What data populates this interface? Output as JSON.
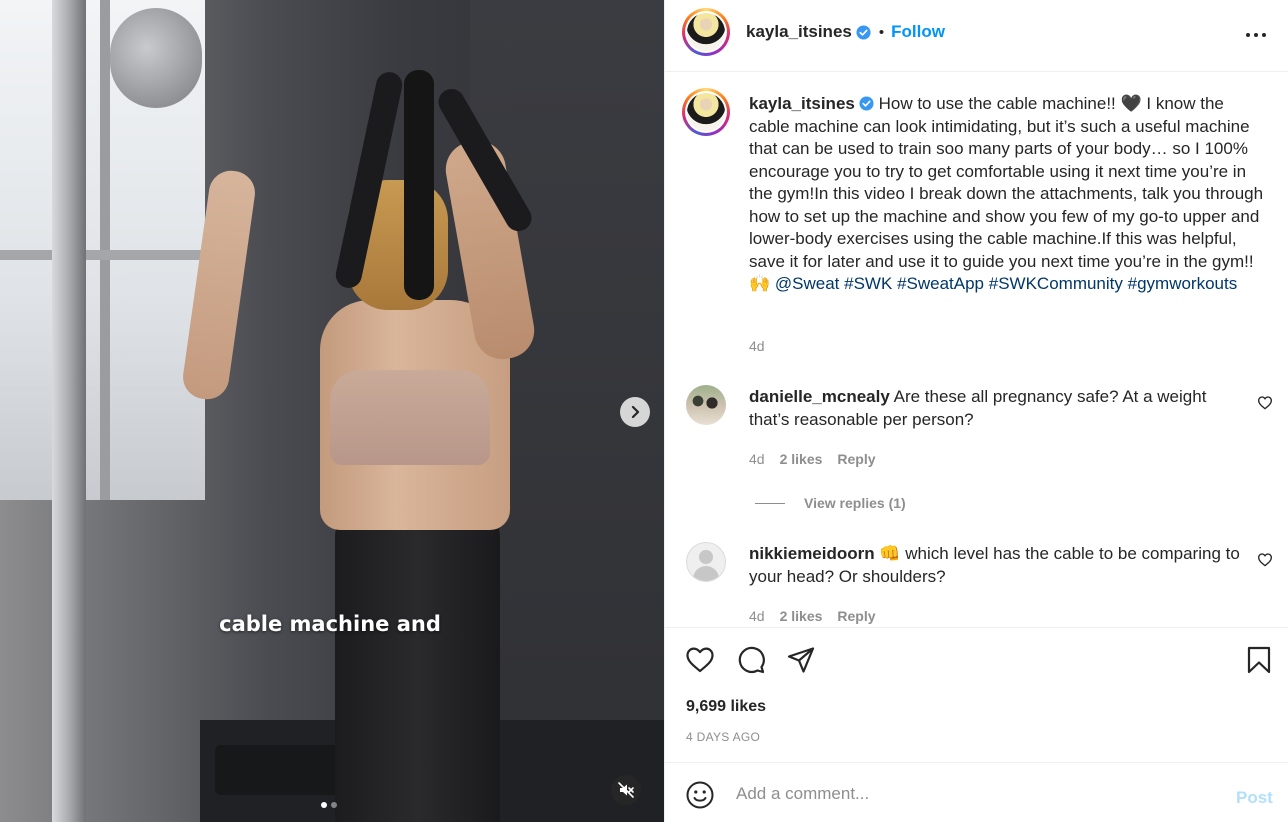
{
  "post": {
    "author": "kayla_itsines",
    "follow_label": "Follow",
    "header_separator": "•",
    "caption_text": "How to use the cable machine!! 🖤 I know the cable machine can look intimidating, but it’s such a useful machine that can be used to train soo many parts of your body… so I 100% encourage you to try to get comfortable using it next time you’re in the gym!In this video I break down the attachments, talk you through how to set up the machine and show you few of my go-to upper and lower-body exercises using the cable machine.If this was helpful, save it for later and use it to guide you next time you’re in the gym!! 🙌 ",
    "caption_tags": [
      "@Sweat",
      "#SWK",
      "#SweatApp",
      "#SWKCommunity",
      "#gymworkouts"
    ],
    "caption_time": "4d",
    "likes": "9,699 likes",
    "date": "4 DAYS AGO"
  },
  "media": {
    "video_caption": "cable machine and",
    "slide_count": 2,
    "current_slide": 1
  },
  "comments": [
    {
      "username": "danielle_mcnealy",
      "text": "Are these all pregnancy safe? At a weight that’s reasonable per person?",
      "time": "4d",
      "likes": "2 likes",
      "reply_label": "Reply",
      "view_replies": "View replies (1)"
    },
    {
      "username": "nikkiemeidoorn",
      "text": "👊 which level has the cable to be comparing to your head? Or shoulders?",
      "time": "4d",
      "likes": "2 likes",
      "reply_label": "Reply"
    }
  ],
  "composer": {
    "placeholder": "Add a comment...",
    "post_label": "Post"
  },
  "icons": {
    "verified": "verified-badge-icon",
    "more": "more-options-icon",
    "like": "heart-icon",
    "comment": "comment-icon",
    "share": "share-icon",
    "save": "bookmark-icon",
    "emoji": "emoji-icon",
    "next": "chevron-right-icon",
    "mute": "muted-speaker-icon"
  },
  "colors": {
    "accent": "#0095f6",
    "hashtag": "#00376b",
    "muted_text": "#8e8e8e",
    "post_disabled": "#b2dffc"
  }
}
